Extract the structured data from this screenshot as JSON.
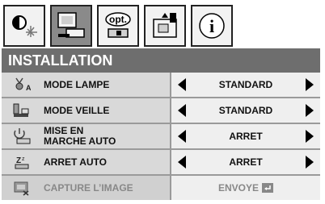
{
  "tabs": [
    {
      "icon": "image-adjust-icon",
      "active": false
    },
    {
      "icon": "installation-icon",
      "active": true
    },
    {
      "icon": "options-icon",
      "label": "opt.",
      "active": false
    },
    {
      "icon": "signal-icon",
      "active": false
    },
    {
      "icon": "info-icon",
      "label": "i",
      "active": false
    }
  ],
  "header": {
    "title": "INSTALLATION"
  },
  "menu": {
    "items": [
      {
        "icon": "lamp-mode-icon",
        "label": "MODE LAMPE",
        "value": "STANDARD"
      },
      {
        "icon": "standby-mode-icon",
        "label": "MODE VEILLE",
        "value": "STANDARD"
      },
      {
        "icon": "auto-power-on-icon",
        "label_line1": "MISE EN",
        "label_line2": "MARCHE AUTO",
        "value": "ARRET"
      },
      {
        "icon": "auto-power-off-icon",
        "label": "ARRET AUTO",
        "value": "ARRET"
      },
      {
        "icon": "capture-image-icon",
        "label": "CAPTURE L’IMAGE",
        "value": "ENVOYE",
        "disabled": true
      }
    ]
  },
  "colors": {
    "header_bg": "#6e6e6e",
    "label_bg": "#d9d9d9",
    "value_bg": "#efefef",
    "active_tab": "#8a8a8a"
  }
}
